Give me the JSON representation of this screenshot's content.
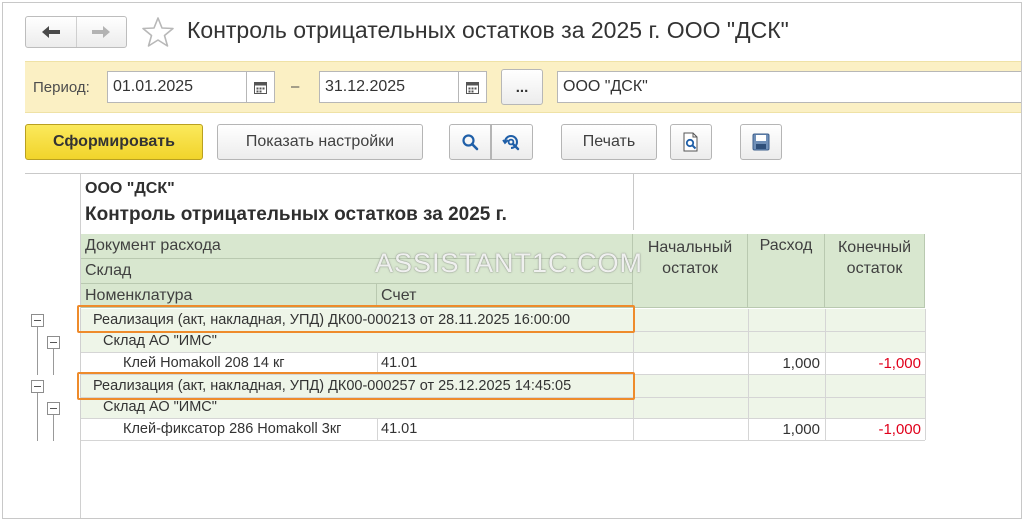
{
  "window": {
    "title": "Контроль отрицательных остатков за 2025 г. ООО \"ДСК\""
  },
  "filter": {
    "period_label": "Период:",
    "date_from": "01.01.2025",
    "date_separator": "–",
    "date_to": "31.12.2025",
    "dots_label": "...",
    "organization": "ООО \"ДСК\""
  },
  "toolbar": {
    "generate_label": "Сформировать",
    "settings_label": "Показать настройки",
    "print_label": "Печать"
  },
  "report": {
    "organization": "ООО \"ДСК\"",
    "title": "Контроль отрицательных остатков за 2025 г.",
    "headers": {
      "document": "Документ расхода",
      "warehouse": "Склад",
      "nomenclature": "Номенклатура",
      "account": "Счет",
      "opening": "Начальный остаток",
      "expense": "Расход",
      "closing": "Конечный остаток"
    },
    "rows": [
      {
        "document": "Реализация (акт, накладная, УПД) ДК00-000213 от 28.11.2025 16:00:00",
        "warehouse": "Склад АО \"ИМС\"",
        "item": "Клей Homakoll 208 14 кг",
        "account": "41.01",
        "expense": "1,000",
        "closing": "-1,000"
      },
      {
        "document": "Реализация (акт, накладная, УПД) ДК00-000257 от 25.12.2025 14:45:05",
        "warehouse": "Склад АО \"ИМС\"",
        "item": "Клей-фиксатор 286 Homakoll 3кг",
        "account": "41.01",
        "expense": "1,000",
        "closing": "-1,000"
      }
    ]
  },
  "watermark": "ASSISTANT1C.COM",
  "colors": {
    "primary_button": "#f4dc3a",
    "header_bg": "#d8e7cf",
    "group_row_bg": "#eef5e8",
    "period_bar_bg": "#fbf0c4",
    "highlight": "#ee8b2b",
    "negative": "#e0001b"
  }
}
